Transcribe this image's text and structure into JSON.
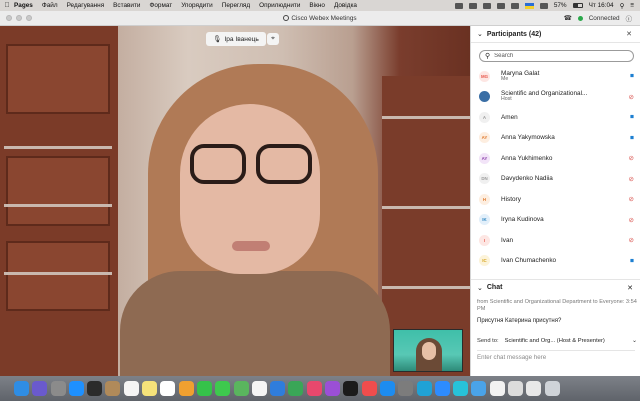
{
  "menubar": {
    "app": "Pages",
    "items": [
      "Файл",
      "Редагування",
      "Вставити",
      "Формат",
      "Упорядити",
      "Перегляд",
      "Оприлюднити",
      "Вікно",
      "Довідка"
    ],
    "battery": "57%",
    "clock": "Чт 16:04"
  },
  "window": {
    "title": "Cisco Webex Meetings",
    "connection": "Connected"
  },
  "video": {
    "speaker_name": "Іра Іванець"
  },
  "participants": {
    "header": "Participants (42)",
    "search_placeholder": "Search",
    "items": [
      {
        "initials": "MG",
        "name": "Maryna Galat",
        "role": "Me",
        "status": "video",
        "avatar_color": "#e8584c",
        "avatar_bg": "#fde6e3"
      },
      {
        "initials": "",
        "name": "Scientific and Organizational...",
        "role": "Host",
        "status": "muted",
        "avatar_color": "#ffffff",
        "avatar_bg": "#3a6ea5"
      },
      {
        "initials": "A",
        "name": "Amen",
        "role": "",
        "status": "video",
        "avatar_color": "#9a9a9a",
        "avatar_bg": "#f0f0f0"
      },
      {
        "initials": "AY",
        "name": "Anna Yakymowska",
        "role": "",
        "status": "video",
        "avatar_color": "#e07a2e",
        "avatar_bg": "#fdeee0"
      },
      {
        "initials": "AY",
        "name": "Anna Yukhimenko",
        "role": "",
        "status": "muted",
        "avatar_color": "#8e44ad",
        "avatar_bg": "#f2e4f8"
      },
      {
        "initials": "DN",
        "name": "Davydenko Nadiia",
        "role": "",
        "status": "muted",
        "avatar_color": "#9a9a9a",
        "avatar_bg": "#f0f0f0"
      },
      {
        "initials": "H",
        "name": "History",
        "role": "",
        "status": "muted",
        "avatar_color": "#e07a2e",
        "avatar_bg": "#fdeee0"
      },
      {
        "initials": "IK",
        "name": "Iryna Kudinova",
        "role": "",
        "status": "muted",
        "avatar_color": "#2e86c1",
        "avatar_bg": "#e2effa"
      },
      {
        "initials": "I",
        "name": "Ivan",
        "role": "",
        "status": "muted",
        "avatar_color": "#e8584c",
        "avatar_bg": "#fde6e3"
      },
      {
        "initials": "IC",
        "name": "Ivan Chumachenko",
        "role": "",
        "status": "video",
        "avatar_color": "#d4a017",
        "avatar_bg": "#fcf3d9"
      }
    ]
  },
  "chat": {
    "header": "Chat",
    "message_meta": "from Scientific and Organizational Department to Everyone: 3:54 PM",
    "message_text": "Присутня Катерина присутня?",
    "send_to_label": "Send to:",
    "send_to_value": "Scientific and Org... (Host & Presenter)",
    "input_placeholder": "Enter chat message here"
  },
  "dock": {
    "icons": [
      {
        "name": "finder-icon",
        "color": "#2f8de4"
      },
      {
        "name": "siri-icon",
        "color": "#6a5acd"
      },
      {
        "name": "launchpad-icon",
        "color": "#8b8b8b"
      },
      {
        "name": "safari-icon",
        "color": "#1e90ff"
      },
      {
        "name": "photo-booth-icon",
        "color": "#2b2b2b"
      },
      {
        "name": "contacts-icon",
        "color": "#b08a5a"
      },
      {
        "name": "calendar-icon",
        "color": "#f5f5f5"
      },
      {
        "name": "notes-icon",
        "color": "#f5e27a"
      },
      {
        "name": "reminders-icon",
        "color": "#ffffff"
      },
      {
        "name": "photos-icon",
        "color": "#f0a030"
      },
      {
        "name": "facetime-icon",
        "color": "#35c24a"
      },
      {
        "name": "messages-icon",
        "color": "#3ec94e"
      },
      {
        "name": "maps-icon",
        "color": "#5ab55e"
      },
      {
        "name": "music-icon",
        "color": "#f5f5f5"
      },
      {
        "name": "keynote-icon",
        "color": "#2f7ddc"
      },
      {
        "name": "numbers-icon",
        "color": "#3aa657"
      },
      {
        "name": "itunes-icon",
        "color": "#e8486d"
      },
      {
        "name": "podcasts-icon",
        "color": "#9b4fd6"
      },
      {
        "name": "apple-tv-icon",
        "color": "#1b1b1b"
      },
      {
        "name": "news-icon",
        "color": "#f04d4d"
      },
      {
        "name": "app-store-icon",
        "color": "#1d8cf0"
      },
      {
        "name": "system-preferences-icon",
        "color": "#7c7c7c"
      },
      {
        "name": "webex-icon",
        "color": "#1fa2d6"
      },
      {
        "name": "zoom-icon",
        "color": "#2d8cff"
      },
      {
        "name": "webex-meetings-icon",
        "color": "#27c2d9"
      },
      {
        "name": "folder-icon",
        "color": "#4aa3e8"
      },
      {
        "name": "documents-icon",
        "color": "#f2f2f2"
      },
      {
        "name": "preview-icon",
        "color": "#dcdcdc"
      },
      {
        "name": "downloads-icon",
        "color": "#e8e8e8"
      },
      {
        "name": "trash-icon",
        "color": "#cfd3d8"
      }
    ]
  }
}
